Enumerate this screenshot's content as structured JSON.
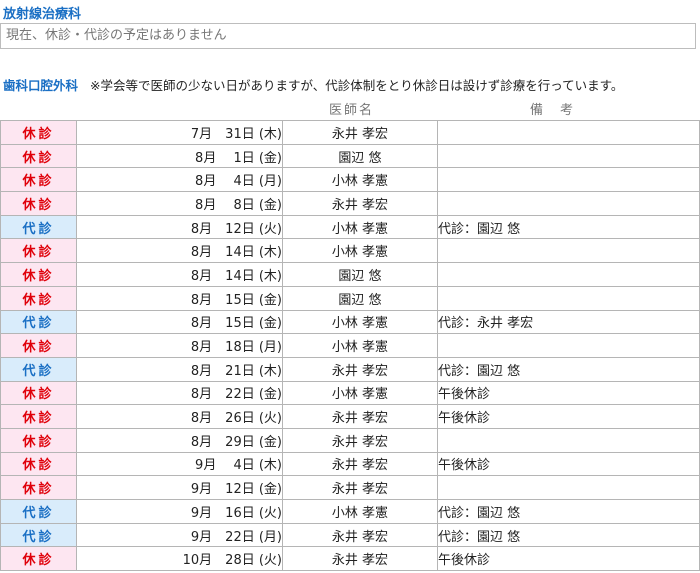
{
  "radiation": {
    "title": "放射線治療科",
    "notice": "現在、休診・代診の予定はありません"
  },
  "dental": {
    "title": "歯科口腔外科",
    "note": "※学会等で医師の少ない日がありますが、代診体制をとり休診日は設けず診療を行っています。",
    "col_doctor": "医師名",
    "col_remark": "備　考",
    "rows": [
      {
        "type": "休診",
        "kind": "kyu",
        "date": "7月　31日 (木)",
        "doctor": "永井 孝宏",
        "remark": ""
      },
      {
        "type": "休診",
        "kind": "kyu",
        "date": "8月　 1日 (金)",
        "doctor": "園辺 悠",
        "remark": ""
      },
      {
        "type": "休診",
        "kind": "kyu",
        "date": "8月　 4日 (月)",
        "doctor": "小林 孝憲",
        "remark": ""
      },
      {
        "type": "休診",
        "kind": "kyu",
        "date": "8月　 8日 (金)",
        "doctor": "永井 孝宏",
        "remark": ""
      },
      {
        "type": "代診",
        "kind": "dai",
        "date": "8月　12日 (火)",
        "doctor": "小林 孝憲",
        "remark": "代診：園辺 悠"
      },
      {
        "type": "休診",
        "kind": "kyu",
        "date": "8月　14日 (木)",
        "doctor": "小林 孝憲",
        "remark": ""
      },
      {
        "type": "休診",
        "kind": "kyu",
        "date": "8月　14日 (木)",
        "doctor": "園辺 悠",
        "remark": ""
      },
      {
        "type": "休診",
        "kind": "kyu",
        "date": "8月　15日 (金)",
        "doctor": "園辺 悠",
        "remark": ""
      },
      {
        "type": "代診",
        "kind": "dai",
        "date": "8月　15日 (金)",
        "doctor": "小林 孝憲",
        "remark": "代診：永井 孝宏"
      },
      {
        "type": "休診",
        "kind": "kyu",
        "date": "8月　18日 (月)",
        "doctor": "小林 孝憲",
        "remark": ""
      },
      {
        "type": "代診",
        "kind": "dai",
        "date": "8月　21日 (木)",
        "doctor": "永井 孝宏",
        "remark": "代診：園辺 悠"
      },
      {
        "type": "休診",
        "kind": "kyu",
        "date": "8月　22日 (金)",
        "doctor": "小林 孝憲",
        "remark": "午後休診"
      },
      {
        "type": "休診",
        "kind": "kyu",
        "date": "8月　26日 (火)",
        "doctor": "永井 孝宏",
        "remark": "午後休診"
      },
      {
        "type": "休診",
        "kind": "kyu",
        "date": "8月　29日 (金)",
        "doctor": "永井 孝宏",
        "remark": ""
      },
      {
        "type": "休診",
        "kind": "kyu",
        "date": "9月　 4日 (木)",
        "doctor": "永井 孝宏",
        "remark": "午後休診"
      },
      {
        "type": "休診",
        "kind": "kyu",
        "date": "9月　12日 (金)",
        "doctor": "永井 孝宏",
        "remark": ""
      },
      {
        "type": "代診",
        "kind": "dai",
        "date": "9月　16日 (火)",
        "doctor": "小林 孝憲",
        "remark": "代診：園辺 悠"
      },
      {
        "type": "代診",
        "kind": "dai",
        "date": "9月　22日 (月)",
        "doctor": "永井 孝宏",
        "remark": "代診：園辺 悠"
      },
      {
        "type": "休診",
        "kind": "kyu",
        "date": "10月　28日 (火)",
        "doctor": "永井 孝宏",
        "remark": "午後休診"
      }
    ]
  }
}
